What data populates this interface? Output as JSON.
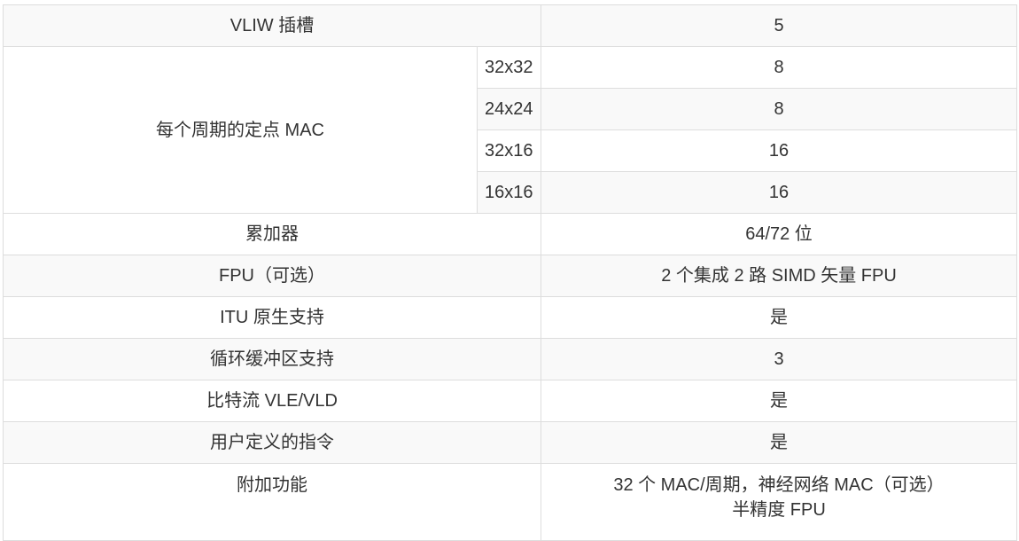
{
  "table": {
    "rows": {
      "vliw": {
        "label": "VLIW 插槽",
        "value": "5"
      },
      "mac": {
        "label": "每个周期的定点 MAC",
        "sub": [
          {
            "size": "32x32",
            "value": "8"
          },
          {
            "size": "24x24",
            "value": "8"
          },
          {
            "size": "32x16",
            "value": "16"
          },
          {
            "size": "16x16",
            "value": "16"
          }
        ]
      },
      "accumulator": {
        "label": "累加器",
        "value": "64/72 位"
      },
      "fpu": {
        "label": "FPU（可选）",
        "value": "2 个集成 2 路 SIMD 矢量 FPU"
      },
      "itu": {
        "label": "ITU 原生支持",
        "value": "是"
      },
      "circular": {
        "label": "循环缓冲区支持",
        "value": "3"
      },
      "bitstream": {
        "label": "比特流 VLE/VLD",
        "value": "是"
      },
      "user_instr": {
        "label": "用户定义的指令",
        "value": "是"
      },
      "extra": {
        "label": "附加功能",
        "value_line1": "32 个 MAC/周期，神经网络 MAC（可选）",
        "value_line2": "半精度 FPU"
      }
    }
  }
}
